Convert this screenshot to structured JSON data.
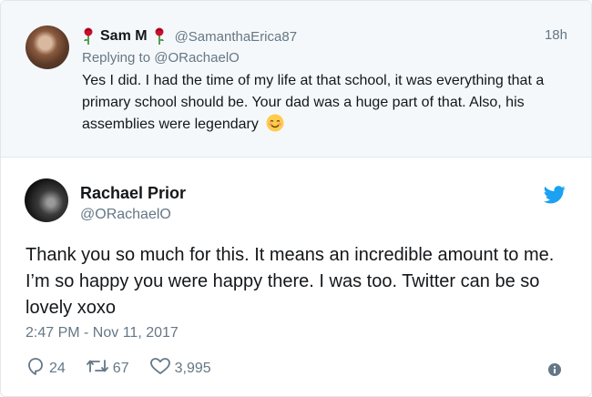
{
  "reply": {
    "name": "Sam M",
    "handle": "@SamanthaErica87",
    "time": "18h",
    "replying_prefix": "Replying to",
    "replying_handle": "@ORachaelO",
    "text": "Yes I did. I had the time of my life at that school, it was everything that a primary school should be. Your dad was a huge part of that. Also, his assemblies were legendary"
  },
  "tweet": {
    "name": "Rachael Prior",
    "handle": "@ORachaelO",
    "text": "Thank you so much for this. It means an incredible amount to me. I’m so happy you were happy there. I was too. Twitter can be so lovely xoxo",
    "timestamp": "2:47 PM - Nov 11, 2017",
    "replies": "24",
    "retweets": "67",
    "likes": "3,995"
  },
  "icons": {
    "rose": "rose-icon",
    "emoji": "smiling-face-icon",
    "bird": "twitter-bird-icon",
    "reply": "reply-icon",
    "retweet": "retweet-icon",
    "like": "heart-icon",
    "info": "info-icon"
  },
  "colors": {
    "brand": "#1da1f2",
    "secondary_text": "#657786",
    "reply_background": "#f5f8fa"
  }
}
